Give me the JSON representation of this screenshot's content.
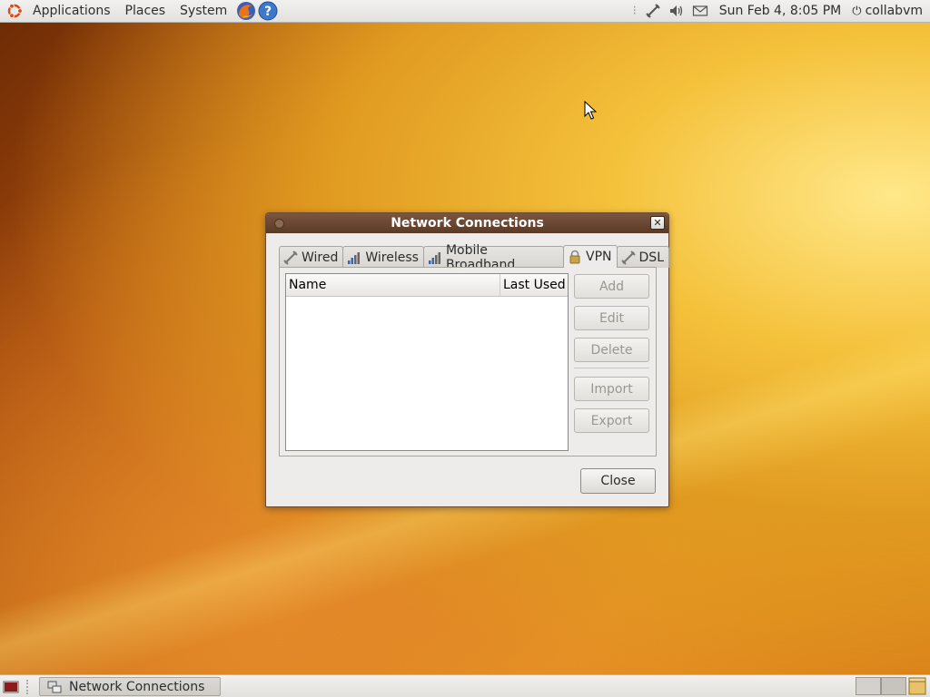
{
  "top_panel": {
    "menus": [
      "Applications",
      "Places",
      "System"
    ],
    "launchers": [
      "firefox-icon",
      "help-icon"
    ],
    "clock": "Sun Feb  4,  8:05 PM",
    "user": "collabvm",
    "tray_icons": [
      "network-icon",
      "volume-icon",
      "mail-icon"
    ]
  },
  "dialog": {
    "title": "Network Connections",
    "tabs": [
      {
        "label": "Wired",
        "icon": "wired-icon",
        "active": false
      },
      {
        "label": "Wireless",
        "icon": "wireless-icon",
        "active": false
      },
      {
        "label": "Mobile Broadband",
        "icon": "mobile-broadband-icon",
        "active": false
      },
      {
        "label": "VPN",
        "icon": "lock-icon",
        "active": true
      },
      {
        "label": "DSL",
        "icon": "dsl-icon",
        "active": false
      }
    ],
    "list": {
      "columns": [
        "Name",
        "Last Used"
      ],
      "rows": []
    },
    "buttons": {
      "add": "Add",
      "edit": "Edit",
      "delete": "Delete",
      "import": "Import",
      "export": "Export",
      "close": "Close"
    }
  },
  "bottom_panel": {
    "task": "Network Connections"
  }
}
